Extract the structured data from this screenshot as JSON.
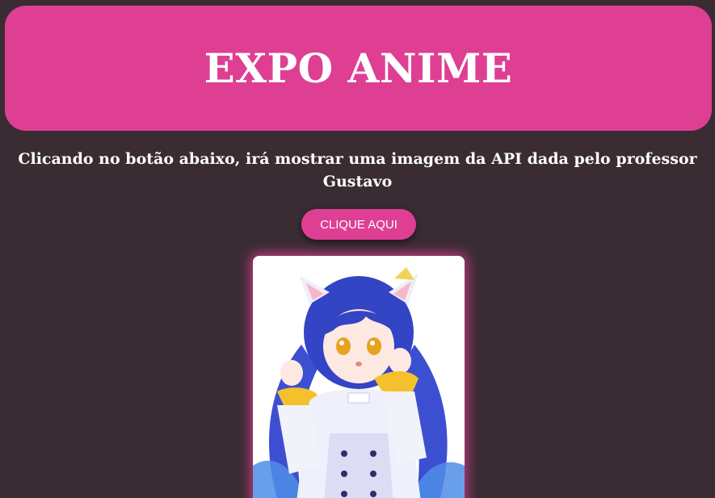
{
  "header": {
    "title": "EXPO ANIME"
  },
  "description": "Clicando no botão abaixo, irá mostrar uma imagem da API dada pelo professor Gustavo",
  "button": {
    "label": "CLIQUE AQUI"
  },
  "colors": {
    "accent": "#de3f93",
    "background": "#3a2c33"
  }
}
